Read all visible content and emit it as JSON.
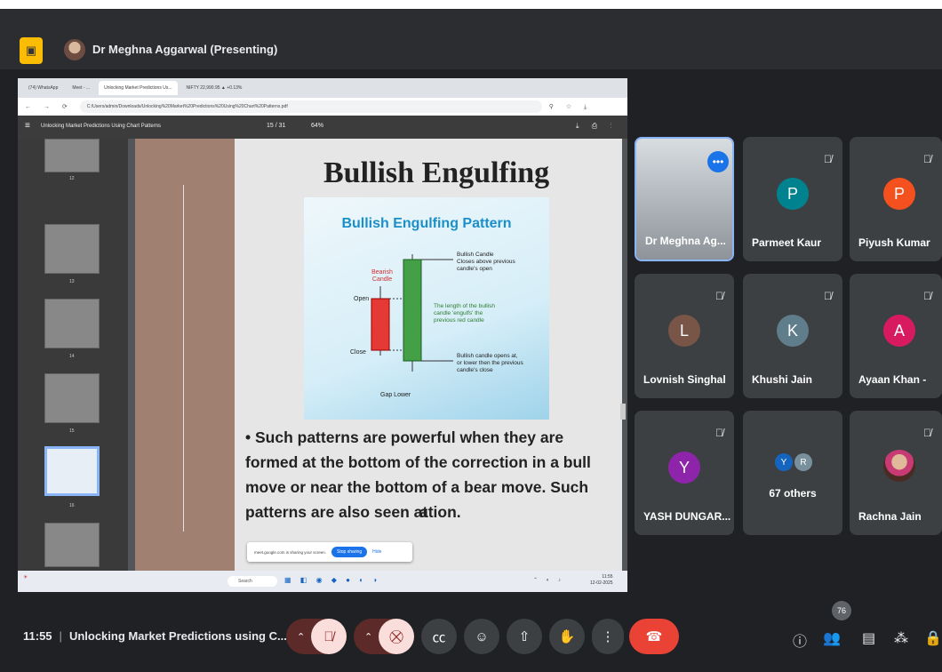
{
  "header": {
    "presenter_name": "Dr Meghna Aggarwal (Presenting)"
  },
  "browser": {
    "tabs": [
      "(74) WhatsApp",
      "Meet - ...",
      "Unlocking Market Predictions Us...",
      "NIFTY 22,990.95 ▲ +0.13%"
    ],
    "url": "C:/Users/admin/Downloads/Unlocking%20Market%20Predictions%20Using%20Chart%20Patterns.pdf"
  },
  "pdf": {
    "title": "Unlocking Market Predictions Using Chart Patterns",
    "page": "15 / 31",
    "zoom": "64%",
    "thumb_numbers": [
      "12",
      "13",
      "14",
      "15",
      "16"
    ],
    "slide_title": "Bullish Engulfing",
    "diagram_title": "Bullish Engulfing Pattern",
    "diagram_labels": {
      "bearish": "Bearish Candle",
      "bullish": "Bullish Candle Closes above previous candle's open",
      "open": "Open",
      "close": "Close",
      "middle": "The length of the bullish candle 'engulfs' the previous red candle",
      "bottom_note": "Bullish candle opens at, or lower then the previous candle's close",
      "gap": "Gap Lower"
    },
    "bullet_text": "• Such patterns are powerful when they are formed at the bottom of the correction in a bull move or near the bottom of a bear move. Such patterns are also seen at",
    "bullet_tail": "ation."
  },
  "share_toast": {
    "text": "meet.google.com is sharing your screen.",
    "stop_label": "Stop sharing",
    "hide_label": "Hide"
  },
  "taskbar": {
    "search": "Search",
    "time": "11:55",
    "date": "12-02-2025"
  },
  "participants": [
    {
      "name": "Dr Meghna Ag...",
      "initial": "",
      "color": ""
    },
    {
      "name": "Parmeet Kaur",
      "initial": "P",
      "color": "#00838f"
    },
    {
      "name": "Piyush Kumar",
      "initial": "P",
      "color": "#f4511e"
    },
    {
      "name": "Lovnish Singhal",
      "initial": "L",
      "color": "#795548"
    },
    {
      "name": "Khushi Jain",
      "initial": "K",
      "color": "#607d8b"
    },
    {
      "name": "Ayaan Khan -",
      "initial": "A",
      "color": "#d81b60"
    },
    {
      "name": "YASH DUNGAR...",
      "initial": "Y",
      "color": "#8e24aa"
    },
    {
      "name": "67 others",
      "initial": "",
      "color": ""
    },
    {
      "name": "Rachna Jain",
      "initial": "",
      "color": ""
    }
  ],
  "others_initials": [
    "Y",
    "R"
  ],
  "bottom": {
    "time": "11:55",
    "separator": "|",
    "meeting_title": "Unlocking Market Predictions using C...",
    "people_count": "76"
  }
}
